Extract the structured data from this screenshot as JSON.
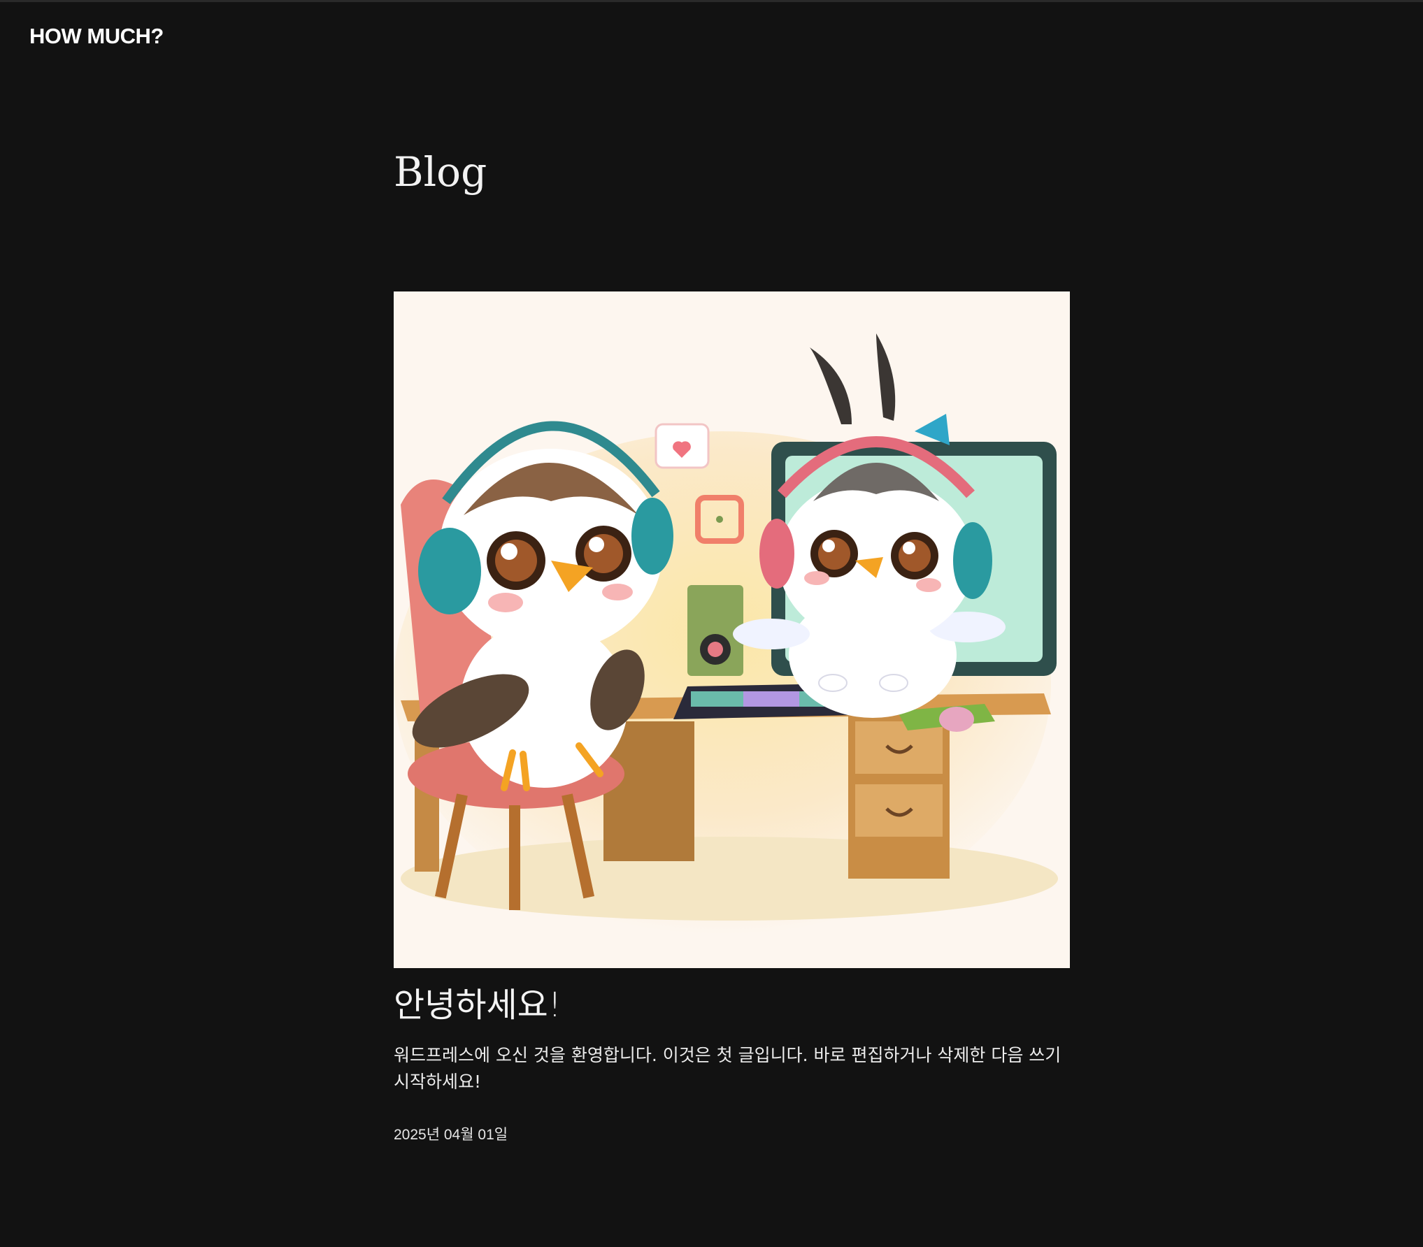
{
  "header": {
    "site_title": "HOW MUCH?"
  },
  "main": {
    "page_title": "Blog",
    "posts": [
      {
        "image": "two-cartoon-birds-with-headsets-at-gaming-desk",
        "title": "안녕하세요!",
        "excerpt": "워드프레스에 오신 것을 환영합니다. 이것은 첫 글입니다. 바로 편집하거나 삭제한 다음 쓰기 시작하세요!",
        "date": "2025년 04월 01일"
      }
    ]
  },
  "colors": {
    "background": "#121212",
    "text": "#f3f3f3",
    "image_background": "#fdf6ef"
  }
}
